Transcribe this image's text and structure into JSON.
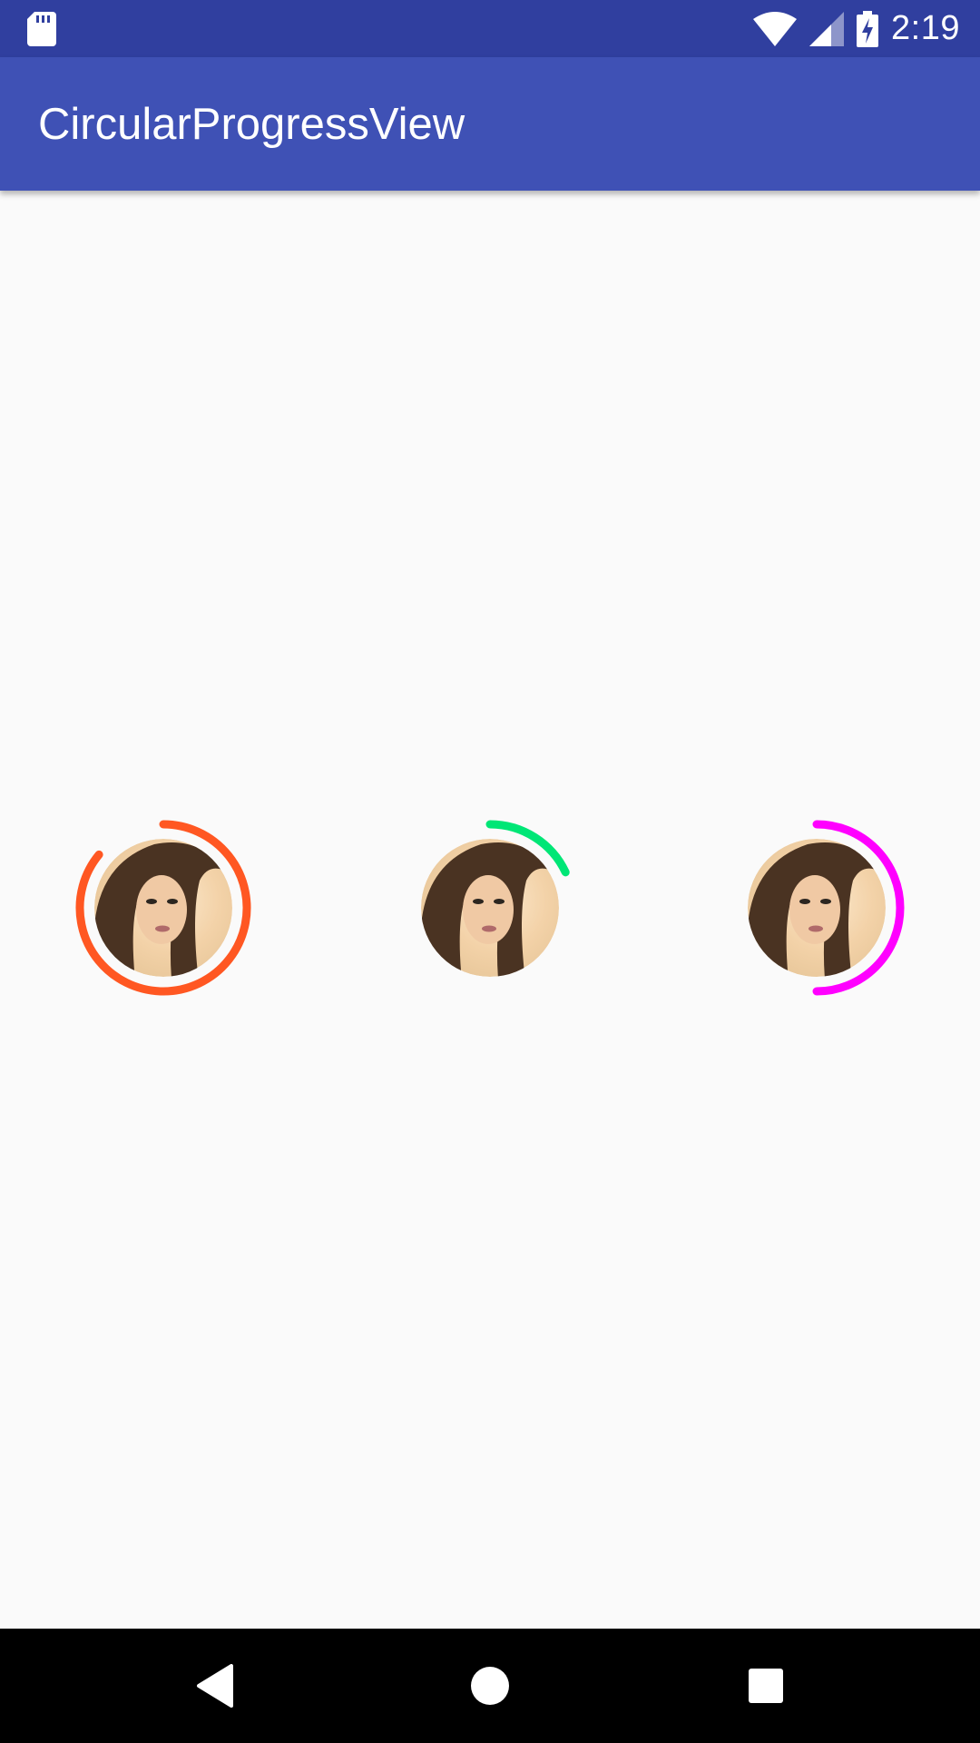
{
  "status_bar": {
    "time": "2:19",
    "icons": [
      "sd-card-icon",
      "wifi-icon",
      "cellular-signal-icon",
      "battery-charging-icon"
    ]
  },
  "app_bar": {
    "title": "CircularProgressView"
  },
  "progress_views": [
    {
      "name": "progress-view-orange",
      "color": "#ff5722",
      "progress_fraction": 0.86,
      "avatar": "portrait-avatar"
    },
    {
      "name": "progress-view-green",
      "color": "#00e676",
      "progress_fraction": 0.18,
      "avatar": "portrait-avatar"
    },
    {
      "name": "progress-view-magenta",
      "color": "#ff00ff",
      "progress_fraction": 0.5,
      "avatar": "portrait-avatar"
    }
  ],
  "nav_bar": {
    "buttons": [
      "back-icon",
      "home-icon",
      "recents-icon"
    ]
  },
  "colors": {
    "status_bar": "#303f9f",
    "app_bar": "#3f51b5",
    "background": "#fafafa"
  }
}
